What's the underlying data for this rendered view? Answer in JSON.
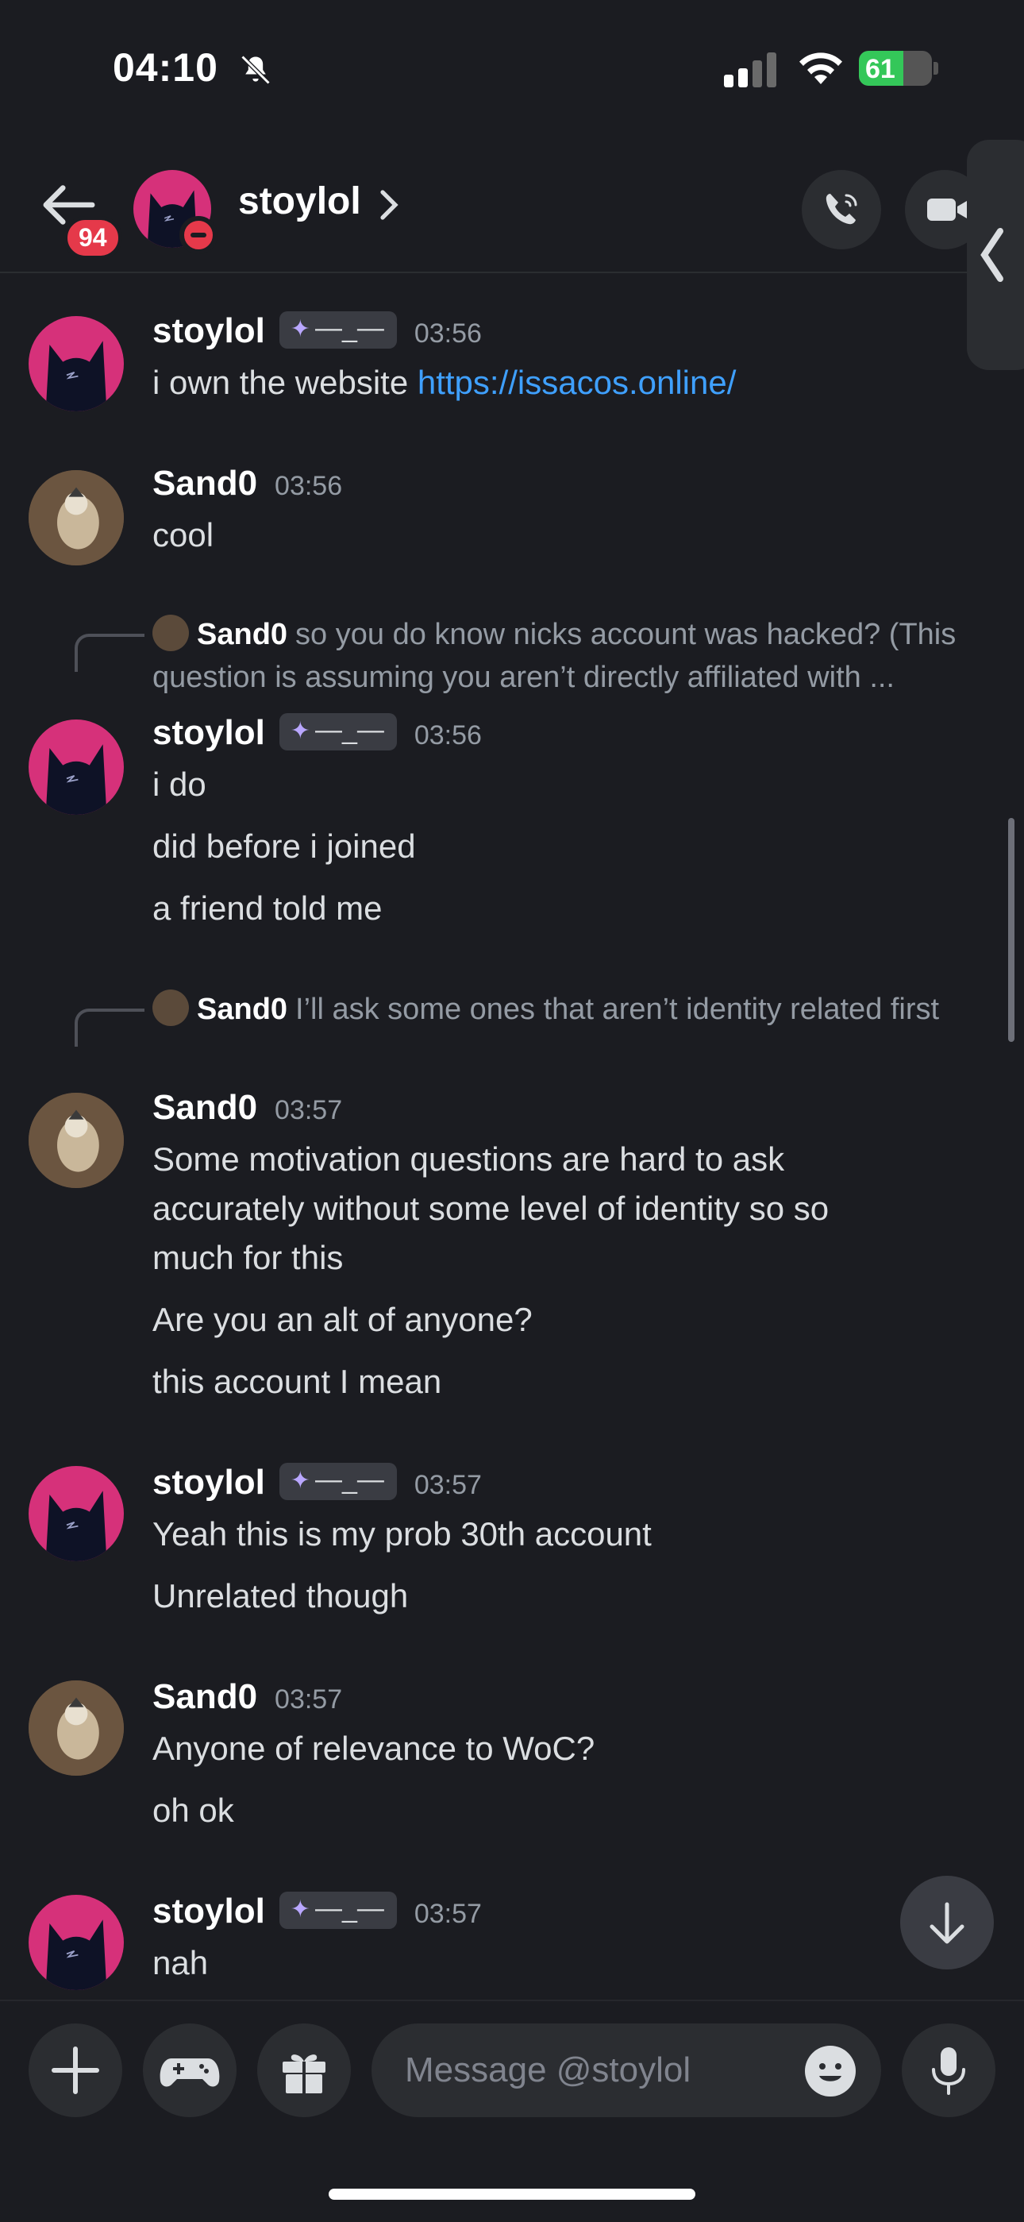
{
  "status_bar": {
    "time": "04:10",
    "battery": "61"
  },
  "header": {
    "unread_count": "94",
    "channel_name": "stoylol"
  },
  "messages": [
    {
      "author": "stoylol",
      "tag": "—_—",
      "time": "03:56",
      "lines": [
        "i own the website "
      ],
      "link": "https://issacos.online/"
    },
    {
      "author": "Sand0",
      "time": "03:56",
      "lines": [
        "cool"
      ]
    },
    {
      "reply_to": {
        "author": "Sand0",
        "text": "so you do know nicks account was hacked? (This question is assuming you aren’t directly affiliated with ..."
      },
      "author": "stoylol",
      "tag": "—_—",
      "time": "03:56",
      "lines": [
        "i do",
        "did before i joined",
        "a friend told me"
      ]
    },
    {
      "reply_to": {
        "author": "Sand0",
        "text": "I’ll ask some ones that aren’t identity related first"
      },
      "author": "Sand0",
      "time": "03:57",
      "lines": [
        "Some motivation questions are hard to ask",
        "accurately without some level of identity so so",
        "much for this",
        "Are you an alt of anyone?",
        "this account I mean"
      ]
    },
    {
      "author": "stoylol",
      "tag": "—_—",
      "time": "03:57",
      "lines": [
        "Yeah this is my prob 30th account",
        "Unrelated though"
      ]
    },
    {
      "author": "Sand0",
      "time": "03:57",
      "lines": [
        "Anyone of relevance to WoC?",
        "oh ok"
      ]
    },
    {
      "author": "stoylol",
      "tag": "—_—",
      "time": "03:57",
      "lines": [
        "nah"
      ]
    }
  ],
  "composer": {
    "placeholder": "Message @stoylol"
  },
  "colors": {
    "background": "#1b1c21",
    "link": "#3fa0ff",
    "accent_pink": "#d6317a",
    "dnd_red": "#e5394a",
    "battery_green": "#34c759"
  },
  "icons": [
    "bell-slash-icon",
    "signal-icon",
    "wifi-icon",
    "battery-icon",
    "back-arrow-icon",
    "chevron-right-icon",
    "phone-icon",
    "video-icon",
    "sidebar-tab-icon",
    "arrow-down-icon",
    "plus-icon",
    "gamepad-icon",
    "gift-icon",
    "emoji-icon",
    "microphone-icon"
  ]
}
